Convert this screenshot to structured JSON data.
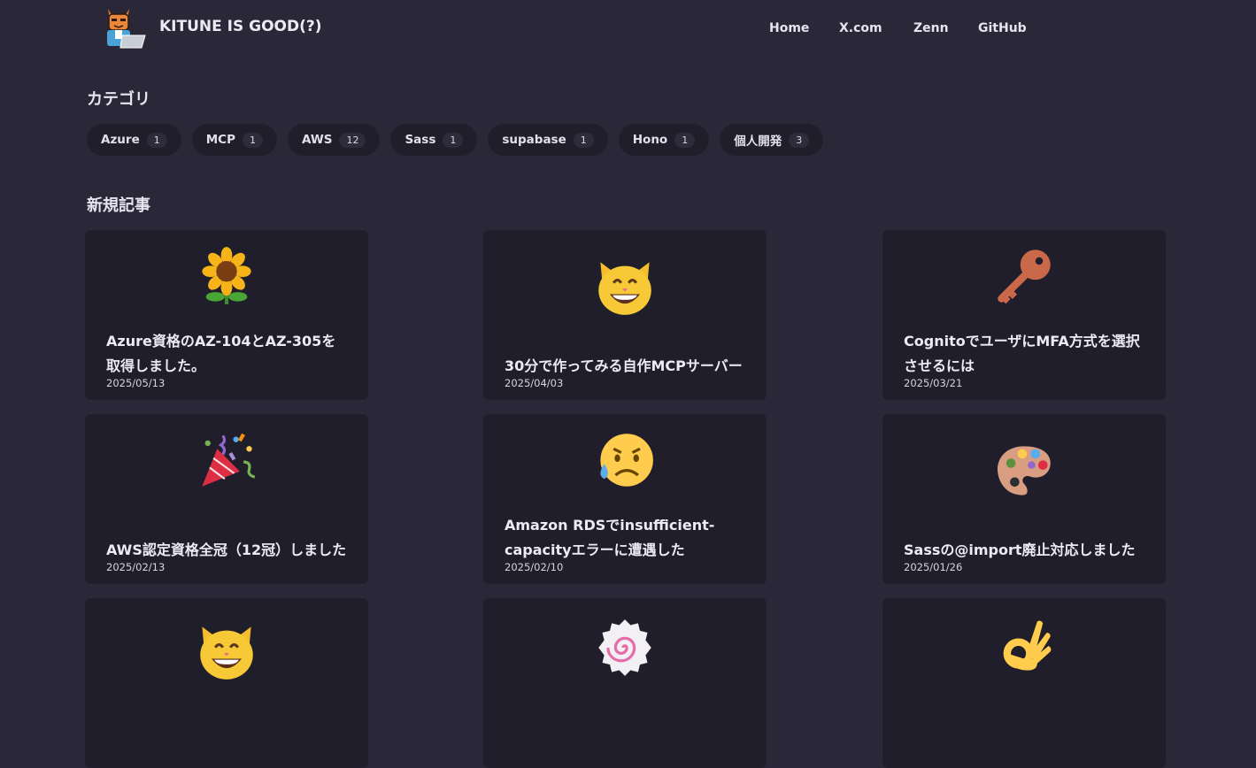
{
  "header": {
    "site_title": "KITUNE IS GOOD(?)",
    "logo_icon": "fox-engineer-avatar-icon",
    "nav": [
      {
        "label": "Home"
      },
      {
        "label": "X.com"
      },
      {
        "label": "Zenn"
      },
      {
        "label": "GitHub"
      }
    ]
  },
  "categories": {
    "title": "カテゴリ",
    "items": [
      {
        "name": "Azure",
        "count": "1"
      },
      {
        "name": "MCP",
        "count": "1"
      },
      {
        "name": "AWS",
        "count": "12"
      },
      {
        "name": "Sass",
        "count": "1"
      },
      {
        "name": "supabase",
        "count": "1"
      },
      {
        "name": "Hono",
        "count": "1"
      },
      {
        "name": "個人開発",
        "count": "3"
      }
    ]
  },
  "articles": {
    "title": "新規記事",
    "items": [
      {
        "emoji": "sunflower-icon",
        "title": "Azure資格のAZ-104とAZ-305を取得しました。",
        "date": "2025/05/13"
      },
      {
        "emoji": "smiling-cat-icon",
        "title": "30分で作ってみる自作MCPサーバー",
        "date": "2025/04/03"
      },
      {
        "emoji": "key-icon",
        "title": "CognitoでユーザにMFA方式を選択させるには",
        "date": "2025/03/21"
      },
      {
        "emoji": "party-popper-icon",
        "title": "AWS認定資格全冠（12冠）しました",
        "date": "2025/02/13"
      },
      {
        "emoji": "anxious-sweat-face-icon",
        "title": "Amazon RDSでinsufficient-capacityエラーに遭遇した",
        "date": "2025/02/10"
      },
      {
        "emoji": "palette-icon",
        "title": "Sassの@import廃止対応しました",
        "date": "2025/01/26"
      },
      {
        "emoji": "smiling-cat-icon",
        "title": "",
        "date": ""
      },
      {
        "emoji": "fish-cake-swirl-icon",
        "title": "",
        "date": ""
      },
      {
        "emoji": "ok-hand-icon",
        "title": "",
        "date": ""
      }
    ]
  },
  "colors": {
    "background": "#2a2838",
    "card": "#1f1e2a",
    "text": "#ecebf3"
  }
}
